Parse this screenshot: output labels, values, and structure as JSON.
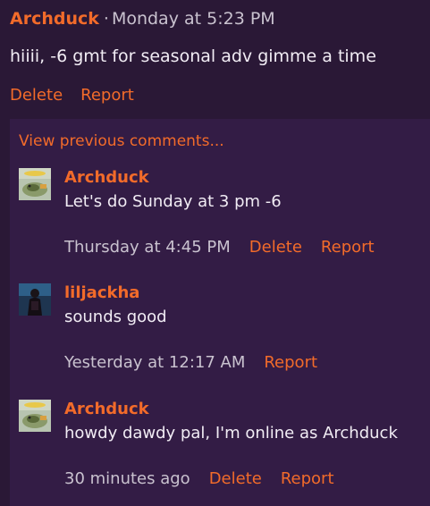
{
  "colors": {
    "background": "#2a1836",
    "panel": "#331c45",
    "accent": "#f26b2a",
    "text": "#f1ecf4",
    "muted": "#c9c2cf"
  },
  "post": {
    "author": "Archduck",
    "separator": "·",
    "time": "Monday at 5:23 PM",
    "body": "hiiii, -6 gmt for seasonal adv gimme a time",
    "delete_label": "Delete",
    "report_label": "Report"
  },
  "comments_panel": {
    "view_previous_label": "View previous comments..."
  },
  "comments": [
    {
      "avatar_icon": "duck-avatar-icon",
      "author": "Archduck",
      "text": "Let's do Sunday at 3 pm -6",
      "time": "Thursday at 4:45 PM",
      "delete_label": "Delete",
      "report_label": "Report"
    },
    {
      "avatar_icon": "person-avatar-icon",
      "author": "liljackha",
      "text": "sounds good",
      "time": "Yesterday at 12:17 AM",
      "report_label": "Report"
    },
    {
      "avatar_icon": "duck-avatar-icon",
      "author": "Archduck",
      "text": "howdy dawdy pal, I'm online as Archduck",
      "time": "30 minutes ago",
      "delete_label": "Delete",
      "report_label": "Report"
    }
  ]
}
